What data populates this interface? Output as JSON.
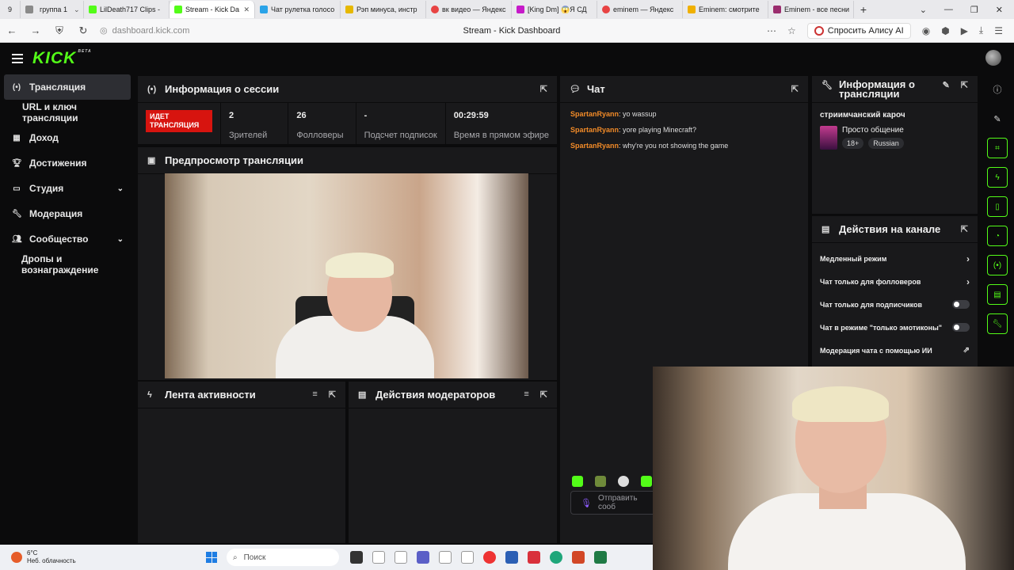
{
  "browser": {
    "tab_count_badge": "9",
    "tabs": [
      {
        "label": "группа 1",
        "color": "#8a8a8a"
      },
      {
        "label": "LilDeath717 Clips -",
        "color": "#53fc18"
      },
      {
        "label": "Stream - Kick Da",
        "color": "#53fc18",
        "active": true
      },
      {
        "label": "Чат рулетка голосо",
        "color": "#2aa3e8"
      },
      {
        "label": "Рэп минуса, инстр",
        "color": "#e6b800"
      },
      {
        "label": "вк видео — Яндекс",
        "color": "#e84343"
      },
      {
        "label": "[King Dm] 😱Я СД",
        "color": "#c61ac9"
      },
      {
        "label": "eminem — Яндекс",
        "color": "#e84343"
      },
      {
        "label": "Eminem: смотрите",
        "color": "#f0b000"
      },
      {
        "label": "Eminem - все песни",
        "color": "#9b2d6e"
      }
    ],
    "url": "dashboard.kick.com",
    "page_title": "Stream - Kick Dashboard",
    "alice_label": "Спросить Алису AI"
  },
  "sidebar": {
    "items": [
      {
        "label": "Трансляция",
        "icon": "broadcast-icon"
      },
      {
        "label": "URL и ключ трансляции"
      },
      {
        "label": "Доход",
        "icon": "income-icon"
      },
      {
        "label": "Достижения",
        "icon": "trophy-icon"
      },
      {
        "label": "Студия",
        "icon": "studio-icon"
      },
      {
        "label": "Модерация",
        "icon": "wrench-icon"
      },
      {
        "label": "Сообщество",
        "icon": "community-icon"
      },
      {
        "label": "Дропы и вознаграждение"
      }
    ]
  },
  "session": {
    "title": "Информация о сессии",
    "live_badge": "ИДЕТ ТРАНСЛЯЦИЯ",
    "stats": [
      {
        "value": "2",
        "label": "Зрителей"
      },
      {
        "value": "26",
        "label": "Фолловеры"
      },
      {
        "value": "-",
        "label": "Подсчет подписок"
      },
      {
        "value": "00:29:59",
        "label": "Время в прямом эфире"
      }
    ]
  },
  "preview": {
    "title": "Предпросмотр трансляции"
  },
  "activity": {
    "title": "Лента активности"
  },
  "modactions": {
    "title": "Действия модераторов"
  },
  "chat": {
    "title": "Чат",
    "messages": [
      {
        "user": "SpartanRyann",
        "text": ": yo wassup"
      },
      {
        "user": "SpartanRyann",
        "text": ": yore playing Minecraft?"
      },
      {
        "user": "SpartanRyann",
        "text": ": why're you not showing the game"
      }
    ],
    "input_placeholder": "Отправить сооб"
  },
  "streaminfo": {
    "title": "Информация о трансляции",
    "stream_title": "стриимчанский кароч",
    "category": "Просто общение",
    "tags": [
      "18+",
      "Russian"
    ]
  },
  "channel_actions": {
    "title": "Действия на канале",
    "items": [
      {
        "label": "Медленный режим",
        "kind": "chevron"
      },
      {
        "label": "Чат только для фолловеров",
        "kind": "chevron"
      },
      {
        "label": "Чат только для подписчиков",
        "kind": "toggle"
      },
      {
        "label": "Чат в режиме \"только эмотиконы\"",
        "kind": "toggle"
      },
      {
        "label": "Модерация чата с помощью ИИ",
        "kind": "external"
      }
    ]
  },
  "taskbar": {
    "temperature": "6°C",
    "weather": "Неб. облачность",
    "search": "Поиск"
  },
  "colors": {
    "accent": "#53fc18",
    "live": "#d7140f",
    "chat_user": "#f28b28"
  }
}
